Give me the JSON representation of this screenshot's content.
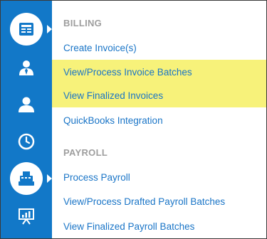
{
  "sidebar": {
    "icons": [
      {
        "name": "billing-icon",
        "active": true
      },
      {
        "name": "employee-icon",
        "active": false
      },
      {
        "name": "user-icon",
        "active": false
      },
      {
        "name": "clock-icon",
        "active": false
      },
      {
        "name": "cash-register-icon",
        "active": true
      },
      {
        "name": "presentation-chart-icon",
        "active": false
      }
    ],
    "colors": {
      "background": "#1278c8",
      "active": "#ffffff"
    }
  },
  "billing": {
    "title": "BILLING",
    "items": [
      {
        "label": "Create Invoice(s)",
        "highlighted": false
      },
      {
        "label": "View/Process Invoice Batches",
        "highlighted": true
      },
      {
        "label": "View Finalized Invoices",
        "highlighted": true
      },
      {
        "label": "QuickBooks Integration",
        "highlighted": false
      }
    ]
  },
  "payroll": {
    "title": "PAYROLL",
    "items": [
      {
        "label": "Process Payroll",
        "highlighted": false
      },
      {
        "label": "View/Process Drafted Payroll Batches",
        "highlighted": false
      },
      {
        "label": "View Finalized Payroll Batches",
        "highlighted": false
      }
    ]
  },
  "colors": {
    "link": "#1a75c7",
    "section_title": "#9e9e9e",
    "highlight": "#f7f27a"
  }
}
